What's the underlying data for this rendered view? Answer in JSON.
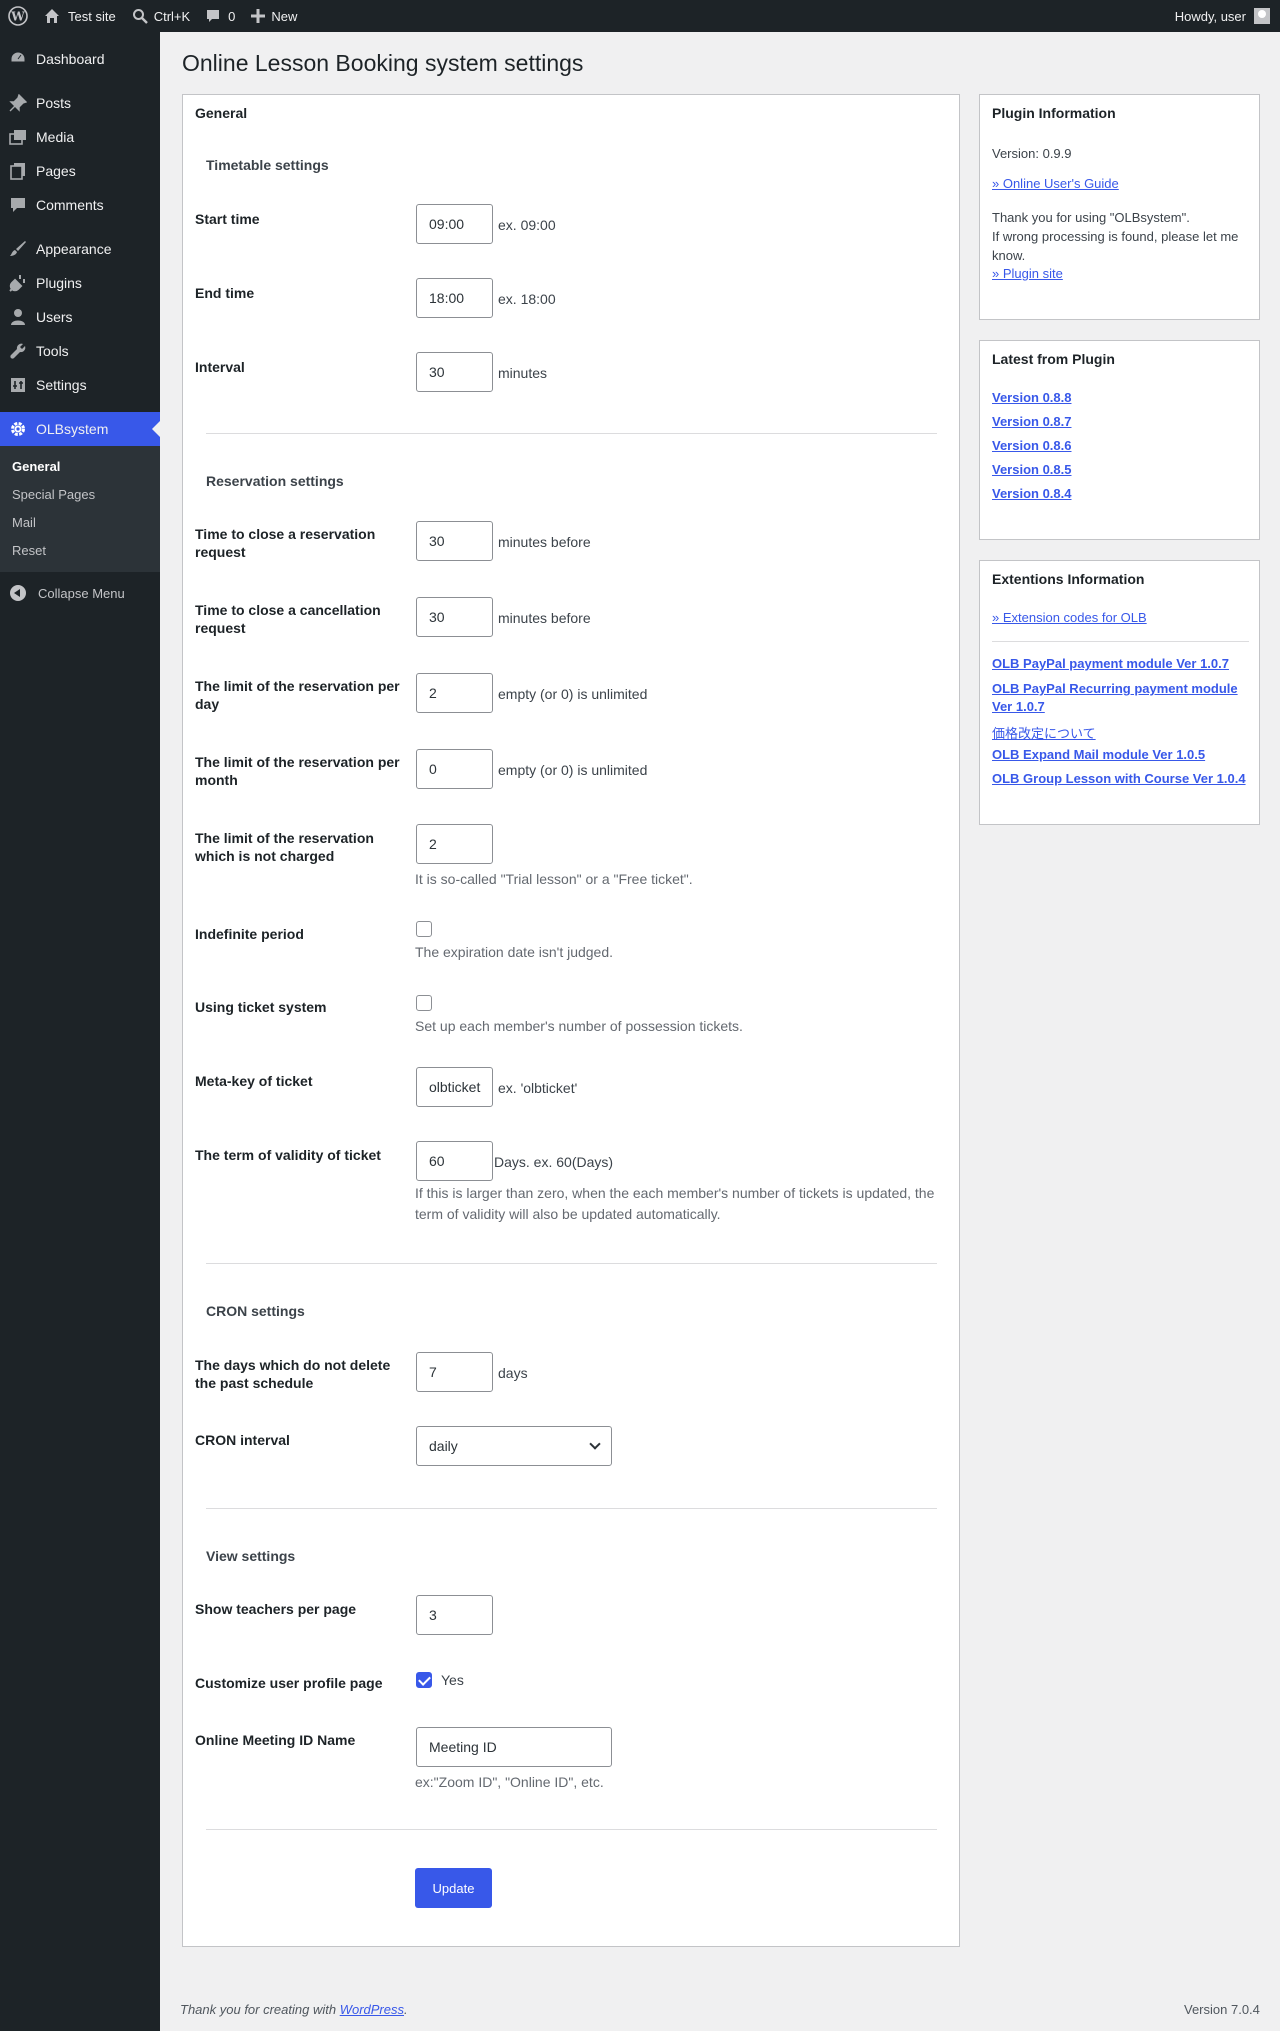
{
  "adminbar": {
    "site_name": "Test site",
    "search_shortcut": "Ctrl+K",
    "comments_count": "0",
    "new_label": "New",
    "howdy": "Howdy, user"
  },
  "sidebar": {
    "items": [
      {
        "label": "Dashboard",
        "icon": "dashboard-icon"
      },
      {
        "label": "Posts",
        "icon": "pin-icon"
      },
      {
        "label": "Media",
        "icon": "media-icon"
      },
      {
        "label": "Pages",
        "icon": "pages-icon"
      },
      {
        "label": "Comments",
        "icon": "comment-icon"
      },
      {
        "label": "Appearance",
        "icon": "brush-icon"
      },
      {
        "label": "Plugins",
        "icon": "plug-icon"
      },
      {
        "label": "Users",
        "icon": "user-icon"
      },
      {
        "label": "Tools",
        "icon": "wrench-icon"
      },
      {
        "label": "Settings",
        "icon": "settings-icon"
      },
      {
        "label": "OLBsystem",
        "icon": "gear-icon"
      }
    ],
    "submenu": [
      "General",
      "Special Pages",
      "Mail",
      "Reset"
    ],
    "collapse": "Collapse Menu"
  },
  "page": {
    "title": "Online Lesson Booking system settings",
    "panel_title": "General"
  },
  "timetable": {
    "title": "Timetable settings",
    "start_label": "Start time",
    "start_value": "09:00",
    "start_suffix": "ex. 09:00",
    "end_label": "End time",
    "end_value": "18:00",
    "end_suffix": "ex. 18:00",
    "interval_label": "Interval",
    "interval_value": "30",
    "interval_suffix": "minutes"
  },
  "reservation": {
    "title": "Reservation settings",
    "close_res_label": "Time to close a reservation request",
    "close_res_value": "30",
    "close_res_suffix": "minutes before",
    "close_cancel_label": "Time to close a cancellation request",
    "close_cancel_value": "30",
    "close_cancel_suffix": "minutes before",
    "limit_day_label": "The limit of the reservation per day",
    "limit_day_value": "2",
    "limit_day_suffix": "empty (or 0) is unlimited",
    "limit_month_label": "The limit of the reservation per month",
    "limit_month_value": "0",
    "limit_month_suffix": "empty (or 0) is unlimited",
    "limit_free_label": "The limit of the reservation which is not charged",
    "limit_free_value": "2",
    "limit_free_desc": "It is so-called \"Trial lesson\" or a \"Free ticket\".",
    "indefinite_label": "Indefinite period",
    "indefinite_desc": "The expiration date isn't judged.",
    "ticket_label": "Using ticket system",
    "ticket_desc": "Set up each member's number of possession tickets.",
    "metakey_label": "Meta-key of ticket",
    "metakey_value": "olbticket",
    "metakey_suffix": "ex. 'olbticket'",
    "validity_label": "The term of validity of ticket",
    "validity_value": "60",
    "validity_suffix": "Days. ex. 60(Days)",
    "validity_desc": "If this is larger than zero, when the each member's number of tickets is updated, the term of validity will also be updated automatically."
  },
  "cron": {
    "title": "CRON settings",
    "days_label": "The days which do not delete the past schedule",
    "days_value": "7",
    "days_suffix": "days",
    "interval_label": "CRON interval",
    "interval_value": "daily"
  },
  "view": {
    "title": "View settings",
    "teachers_label": "Show teachers per page",
    "teachers_value": "3",
    "customize_label": "Customize user profile page",
    "customize_yes": "Yes",
    "meeting_label": "Online Meeting ID Name",
    "meeting_value": "Meeting ID",
    "meeting_desc": "ex:\"Zoom ID\", \"Online ID\", etc."
  },
  "update_button": "Update",
  "plugin_info": {
    "title": "Plugin Information",
    "version": "Version: 0.9.9",
    "guide_link": "» Online User's Guide",
    "thanks_line1": "Thank you for using \"OLBsystem\".",
    "thanks_line2": "If wrong processing is found, please let me know.",
    "site_link": "» Plugin site"
  },
  "latest": {
    "title": "Latest from Plugin",
    "items": [
      "Version 0.8.8",
      "Version 0.8.7",
      "Version 0.8.6",
      "Version 0.8.5",
      "Version 0.8.4"
    ]
  },
  "extensions": {
    "title": "Extentions Information",
    "codes_link": "» Extension codes for OLB",
    "items": [
      "OLB PayPal payment module Ver 1.0.7",
      "OLB PayPal Recurring payment module Ver 1.0.7",
      "価格改定について",
      "OLB Expand Mail module Ver 1.0.5",
      "OLB Group Lesson with Course Ver 1.0.4"
    ]
  },
  "footer": {
    "thanks": "Thank you for creating with ",
    "wp_link": "WordPress",
    "version": "Version 7.0.4"
  },
  "colors": {
    "accent": "#3858e9",
    "sidebar": "#1d2327",
    "background": "#f0f0f1"
  }
}
